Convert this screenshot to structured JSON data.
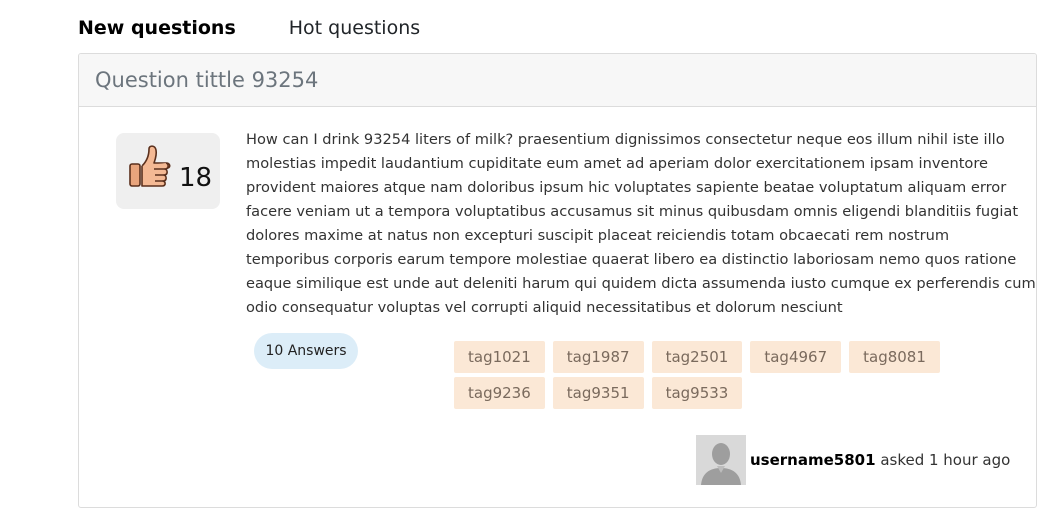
{
  "tabs": {
    "new_label": "New questions",
    "hot_label": "Hot questions"
  },
  "question": {
    "title": "Question tittle 93254",
    "votes": "18",
    "body": "How can I drink 93254 liters of milk? praesentium dignissimos consectetur neque eos illum nihil iste illo molestias impedit laudantium cupiditate eum amet ad aperiam dolor exercitationem ipsam inventore provident maiores atque nam doloribus ipsum hic voluptates sapiente beatae voluptatum aliquam error facere veniam ut a tempora voluptatibus accusamus sit minus quibusdam omnis eligendi blanditiis fugiat dolores maxime at natus non excepturi suscipit placeat reiciendis totam obcaecati rem nostrum temporibus corporis earum tempore molestiae quaerat libero ea distinctio laboriosam nemo quos ratione eaque similique est unde aut deleniti harum qui quidem dicta assumenda iusto cumque ex perferendis cum odio consequatur voluptas vel corrupti aliquid necessitatibus et dolorum nesciunt",
    "answers_label": "10 Answers",
    "tags": [
      "tag1021",
      "tag1987",
      "tag2501",
      "tag4967",
      "tag8081",
      "tag9236",
      "tag9351",
      "tag9533"
    ],
    "author": {
      "username": "username5801",
      "action": "asked 1 hour ago"
    }
  },
  "icons": {
    "vote": "thumbs-up-icon",
    "avatar": "user-avatar-icon"
  },
  "colors": {
    "tag_background": "#fbe8d6",
    "answers_background": "#dcedf8",
    "header_background": "#f7f7f7"
  }
}
